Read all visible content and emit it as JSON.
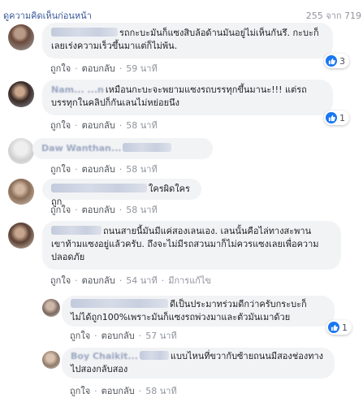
{
  "header": {
    "prev_link": "ดูความคิดเห็นก่อนหน้า",
    "counter": "255 จาก 719"
  },
  "labels": {
    "like": "ถูกใจ",
    "reply": "ตอบกลับ",
    "dot": "·"
  },
  "comments": [
    {
      "name": "",
      "text_line1": "รถกะบะมันก็แซงสิบล้อด้านมันอยู่ไม่เห็นกันรึ. กะบะก็",
      "text_line2": "เลยเร่งความเร็วขึ้นมาแต่ก็ไม่พ้น.",
      "time": "59 นาที",
      "reactions": "3"
    },
    {
      "name": "Nam... ...n",
      "text_line1": "เหมือนกะบะจะพยามแซงรถบรรทุกขึ้นมานะ!!! แต่รถ",
      "text_line2": "บรรทุกในคลิปก็กันเลนไม่หย่อยนึง",
      "time": "58 นาที",
      "reactions": "1"
    },
    {
      "name": "Daw Wanthan...",
      "text_line1": "",
      "text_line2": "",
      "time": "58 นาที",
      "reactions": ""
    },
    {
      "name": "",
      "text_line1": "ใครผิดใครถูก",
      "text_line2": "",
      "time": "58 นาที",
      "reactions": ""
    },
    {
      "name": "",
      "text_line1": "ถนนสายนี้มันมีแค่สองเลนเอง. เลนนั้นคือไล่ทางสะพาน",
      "text_line2": "เขาท้ามแซงอยู่แล้วครับ. ถึงจะไม่มีรถสวนมาก็ไม่ควรแซงเลยเพื่อความ",
      "text_line3": "ปลอดภัย",
      "time": "54 นาที",
      "edited": "มีการแก้ไข"
    },
    {
      "name": "",
      "text_line1": "ดีเป็นประมาทร่วมดีกว่าครับกระบะก็",
      "text_line2": "ไม่ได้ถูก100%เพราะมันก็แซงรถพ่วงมาและตัวมันเมาด้วย",
      "time": "57 นาที",
      "reactions": "1"
    },
    {
      "name": "Boy Chaikit...",
      "text_line1": "แบบไหนที่ขวากับซ้ายถนนมีสองช่องทาง",
      "text_line2": "ไปสองกลับสอง",
      "time": "58 นาที",
      "reactions": ""
    }
  ],
  "colors": {
    "link": "#385898",
    "bubble": "#f2f3f5",
    "meta": "#90949c",
    "like_blue": "#1877f2"
  }
}
